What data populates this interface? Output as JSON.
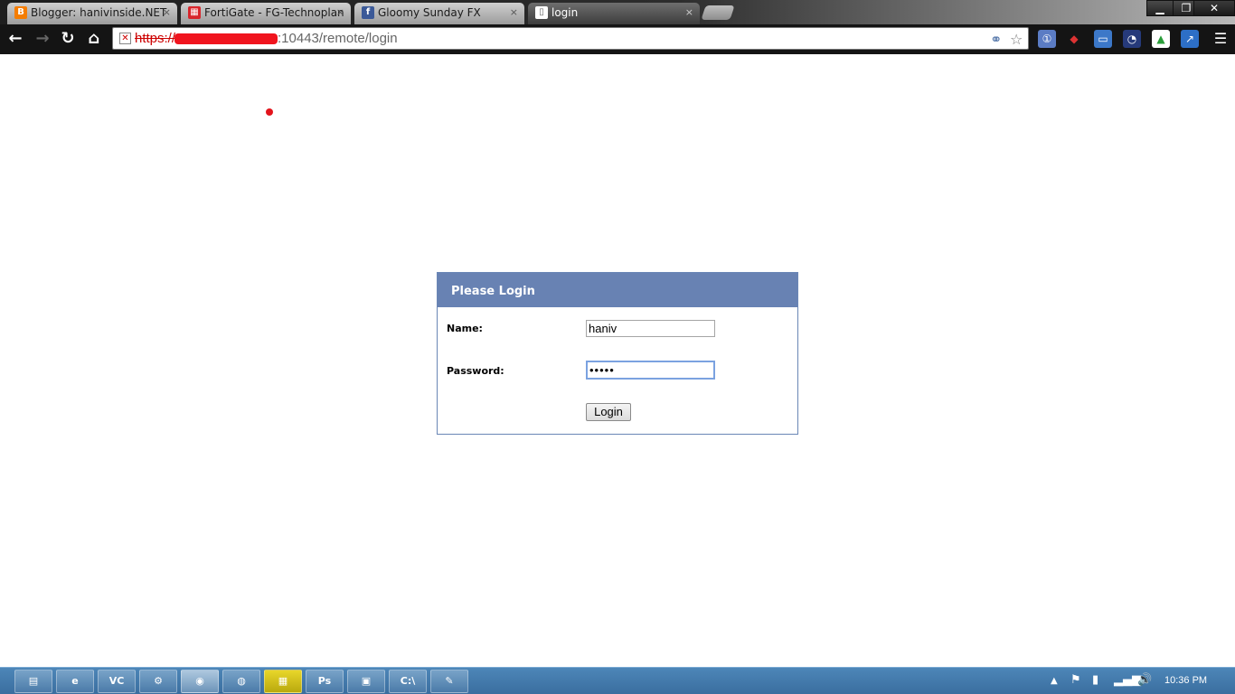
{
  "browser": {
    "tabs": [
      {
        "label": "Blogger: hanivinside.NET",
        "icon": "blogger-icon",
        "color": "#f57d00"
      },
      {
        "label": "FortiGate - FG-Technoplan",
        "icon": "fortigate-icon",
        "color": "#d8252b"
      },
      {
        "label": "Gloomy Sunday FX",
        "icon": "facebook-icon",
        "color": "#3b5998"
      },
      {
        "label": "login",
        "icon": "page-icon",
        "color": "#ffffff"
      }
    ],
    "tab_close_glyph": "×",
    "window_controls": {
      "minimize": "▁",
      "maximize": "❐",
      "close": "✕"
    },
    "nav": {
      "back": "←",
      "forward": "→",
      "reload": "↻",
      "home": "⌂"
    },
    "address": {
      "scheme": "https://",
      "path": ":10443/remote/login",
      "redacted_color": "#f0141e",
      "insecure_icon_glyph": "✕"
    }
  },
  "page": {
    "login": {
      "header": "Please Login",
      "name_label": "Name:",
      "name_value": "haniv",
      "password_label": "Password:",
      "password_value": "•••••",
      "button_label": "Login"
    }
  },
  "taskbar": {
    "apps": [
      {
        "name": "file-explorer",
        "glyph": "▤"
      },
      {
        "name": "ie",
        "glyph": "e"
      },
      {
        "name": "vlc",
        "glyph": "VC"
      },
      {
        "name": "tools",
        "glyph": "⚙"
      },
      {
        "name": "chrome",
        "glyph": "◉"
      },
      {
        "name": "firefox",
        "glyph": "◍"
      },
      {
        "name": "media",
        "glyph": "▦"
      },
      {
        "name": "photoshop",
        "glyph": "Ps"
      },
      {
        "name": "remote-desktop",
        "glyph": "▣"
      },
      {
        "name": "command-prompt",
        "glyph": "C:\\"
      },
      {
        "name": "paint",
        "glyph": "✎"
      }
    ],
    "clock": "10:36 PM"
  }
}
